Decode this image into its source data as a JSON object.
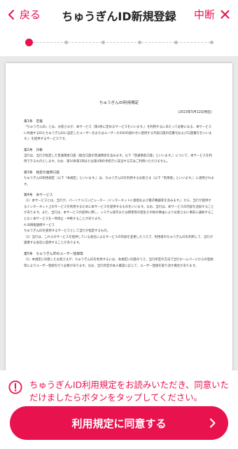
{
  "header": {
    "back_label": "戻る",
    "title": "ちゅうぎんID新規登録",
    "abort_label": "中断"
  },
  "stepper": {
    "total_steps": 6,
    "current_step": 1
  },
  "document": {
    "title": "ちゅうぎんID利用規定",
    "date": "（2023年5月12日現在）",
    "sections": [
      {
        "heading": "第1条　定義",
        "text": "「ちゅうぎんID」とは、お客さまが、本サービス（第4条に定めるサービスをいいます。）を利用するにあたって必要になる、本サービスに共通するIDとちゅうぎんIDに設定したユーザー名またはユーザーそのIDの組わせに使用する代表口座の店番号および口座番号をいいます。）を提供するサービスです。"
      },
      {
        "heading": "第2条　対象",
        "text": "当行は、当行が指定した普通預金口座（総合口座の普通預金を含みます。以下「普通預金口座」といいます。）について、本サービスを利用できるものとします。なお、第10条第3項または第4項の手続きに該当する方はご利用いただけません。"
      },
      {
        "heading": "第3条　指定の連用口座",
        "text": "ちゅうぎんID利用規定（以下「本規定」といいます。）は、ちゅうぎんIDを利用するお客さま（以下「利用者」といいます。）に適用されます。"
      },
      {
        "heading": "第4条　本サービス",
        "text": "（1）本サービスとは、当行が、パーソナルコンピューター（インターネットに接続および電子機器等を含みます。）から、当行が提供するインターネット上のサービスを利用するために本サービスを提供するものをいいます。なお、当行は、本サービスの内容を追加することがあります。また、当行は、本サービスの提供に際し、システム保守または障害等の発生その他の事由によりお客さまに事前に通知することなく本サービスを一時停止・中断することがあります。\nA.ID情報連携サービス\nちゅうぎんIDを使用するサービスとして当行が指定するもの。\n（2）当行は、これらのサービスを提供している会社によるサービスの内容を変更したうえで、利用者のちゅうぎんIDを利用して、当行が連携する会社に提供することがあります。"
      },
      {
        "heading": "第5条　ちゅうぎんIDのユーザー登録等",
        "text": "（1）本規定に同意したお客さまが、ちゅうぎんIDを利用するには、本規定に同意のうえ、当行所定の方法で当行ホームページからの登録等によりユーザー登録を行う必要があります。なお、当行所定の本人確認に応じて、ユーザー登録を取り消す場合があります。"
      }
    ]
  },
  "notice": {
    "icon": "exclamation-circle-icon",
    "text": "ちゅうぎんID利用規定をお読みいただき、同意いただけましたらボタンをタップしてください。"
  },
  "agree_button": {
    "label": "利用規定に同意する"
  },
  "colors": {
    "accent": "#e8134e",
    "doc_bg": "#e9e9e9"
  }
}
